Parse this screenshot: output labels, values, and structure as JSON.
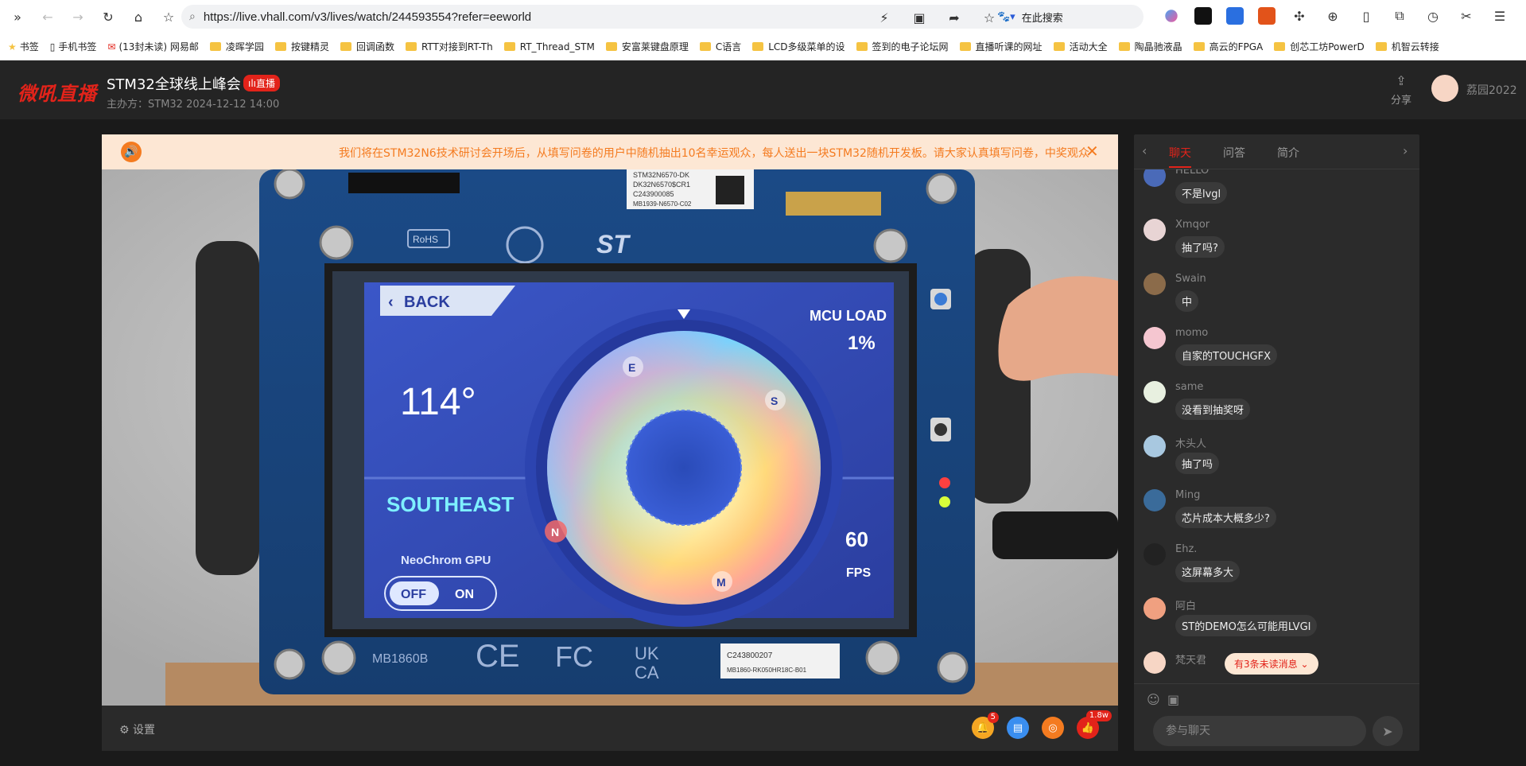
{
  "browser": {
    "url": "https://live.vhall.com/v3/lives/watch/244593554?refer=eeworld",
    "search_placeholder": "在此搜索"
  },
  "bookmarks": [
    {
      "label": "书签"
    },
    {
      "label": "手机书签"
    },
    {
      "label": "(13封未读) 网易邮"
    },
    {
      "label": "凌晖学园"
    },
    {
      "label": "按键精灵"
    },
    {
      "label": "回调函数"
    },
    {
      "label": "RTT对接到RT-Th"
    },
    {
      "label": "RT_Thread_STM"
    },
    {
      "label": "安富莱键盘原理"
    },
    {
      "label": "C语言"
    },
    {
      "label": "LCD多级菜单的设"
    },
    {
      "label": "签到的电子论坛网"
    },
    {
      "label": "直播听课的网址"
    },
    {
      "label": "活动大全"
    },
    {
      "label": "陶晶驰液晶"
    },
    {
      "label": "高云的FPGA"
    },
    {
      "label": "创芯工坊PowerD"
    },
    {
      "label": "机智云转接"
    }
  ],
  "header": {
    "logo": "微吼直播",
    "title": "STM32全球线上峰会",
    "live_badge": "直播",
    "host": "主办方：STM32   2024-12-12 14:00",
    "share_label": "分享",
    "user_name": "荔园2022"
  },
  "notice": {
    "text": "我们将在STM32N6技术研讨会开场后，从填写问卷的用户中随机抽出10名幸运观众，每人送出一块STM32随机开发板。请大家认真填写问卷，中奖观众"
  },
  "device_screen": {
    "back_label": "BACK",
    "mcu_load_label": "MCU LOAD",
    "mcu_load_value": "1%",
    "angle": "114°",
    "direction": "SOUTHEAST",
    "gpu_label": "NeoChrom GPU",
    "toggle_off": "OFF",
    "toggle_on": "ON",
    "fps_value": "60",
    "fps_label": "FPS",
    "compass_e": "E",
    "compass_s": "S",
    "compass_n": "N",
    "compass_w": "M"
  },
  "board_labels": {
    "rohs": "RoHS",
    "board_id": "STM32N6570-DK",
    "board_sub": "DK32N6570$CR1",
    "serial": "C243900085",
    "serial2": "MB1939-N6570-C02",
    "model": "MB1860B",
    "bottom_serial": "C243800207",
    "bottom_serial2": "MB1860-RK050HR18C-B01"
  },
  "video_controls": {
    "settings_label": "设置",
    "notification_count": "5",
    "like_count": "1.8w"
  },
  "chat": {
    "tabs": [
      "聊天",
      "问答",
      "简介"
    ],
    "messages": [
      {
        "name": "HELLO",
        "text": "不是lvgl",
        "avatar_color": "#4a6ab8"
      },
      {
        "name": "Xmqor",
        "text": "抽了吗?",
        "avatar_color": "#e8d4d4"
      },
      {
        "name": "Swain",
        "text": "中",
        "avatar_color": "#8b6b4a"
      },
      {
        "name": "momo",
        "text": "自家的TOUCHGFX",
        "avatar_color": "#f5c6d0"
      },
      {
        "name": "same",
        "text": "没看到抽奖呀",
        "avatar_color": "#e8f0e0"
      },
      {
        "name": "木头人",
        "text": "抽了吗",
        "avatar_color": "#a8c8e0"
      },
      {
        "name": "Ming",
        "text": "芯片成本大概多少?",
        "avatar_color": "#3a6b9a"
      },
      {
        "name": "Ehz.",
        "text": "这屏幕多大",
        "avatar_color": "#222222"
      },
      {
        "name": "阿白",
        "text": "ST的DEMO怎么可能用LVGI",
        "avatar_color": "#f0a080"
      },
      {
        "name": "梵天君",
        "text": "",
        "avatar_color": "#f7d6c5"
      }
    ],
    "unread_label": "有3条未读消息",
    "input_placeholder": "参与聊天"
  }
}
